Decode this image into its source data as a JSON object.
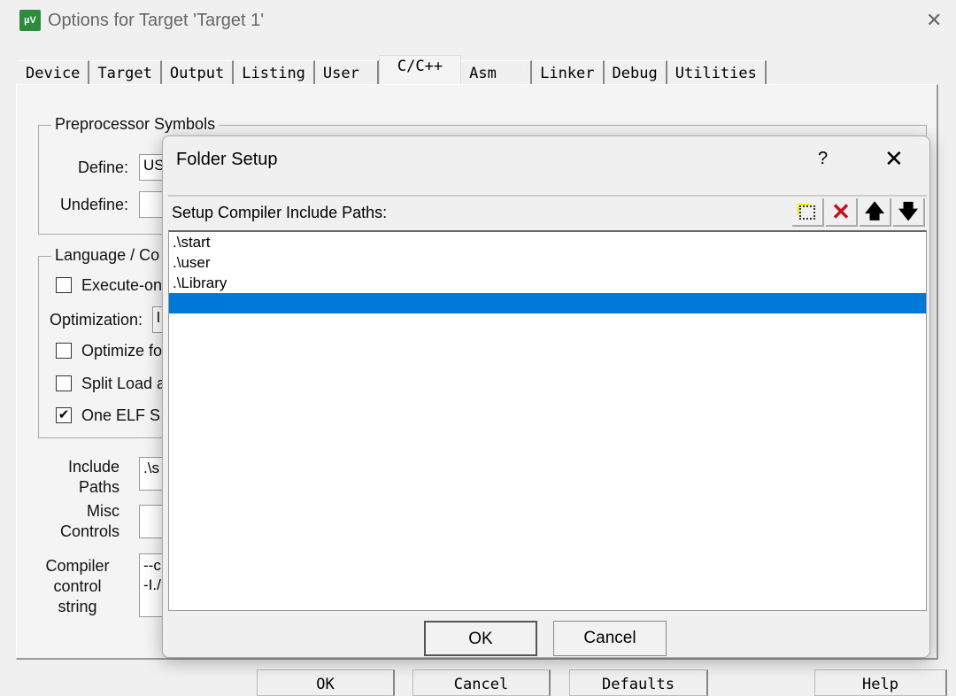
{
  "window": {
    "title": "Options for Target 'Target 1'",
    "icon": "uvision-icon",
    "close": "✕"
  },
  "tabs": [
    "Device",
    "Target",
    "Output",
    "Listing",
    "User",
    "C/C++",
    "Asm",
    "Linker",
    "Debug",
    "Utilities"
  ],
  "active_tab": "C/C++",
  "preprocessor": {
    "title": "Preprocessor Symbols",
    "define_label": "Define:",
    "define_value": "US",
    "undefine_label": "Undefine:",
    "undefine_value": ""
  },
  "language": {
    "title": "Language / Co",
    "execute_only": "Execute-on",
    "optimization_label": "Optimization:",
    "optimization_value": "l",
    "optimize_for": "Optimize fo",
    "split_load": "Split Load a",
    "one_elf": "One ELF S"
  },
  "include_paths": {
    "label1": "Include",
    "label2": "Paths",
    "value": ".\\s"
  },
  "misc": {
    "label1": "Misc",
    "label2": "Controls",
    "value": ""
  },
  "compiler": {
    "label1": "Compiler",
    "label2": "control",
    "label3": "string",
    "line1": "--c",
    "line2": "-I./"
  },
  "bottom_buttons": {
    "ok": "OK",
    "cancel": "Cancel",
    "defaults": "Defaults",
    "help": "Help"
  },
  "folder_setup": {
    "title": "Folder Setup",
    "help": "?",
    "close": "✕",
    "header": "Setup Compiler Include Paths:",
    "toolbar": {
      "new": "new-folder-icon",
      "delete": "delete-icon",
      "up": "move-up-icon",
      "down": "move-down-icon",
      "delete_color": "#c0141e"
    },
    "paths": [
      ".\\start",
      ".\\user",
      ".\\Library",
      ""
    ],
    "selected_index": 3,
    "selection_color": "#0078d7",
    "ok": "OK",
    "cancel": "Cancel"
  }
}
